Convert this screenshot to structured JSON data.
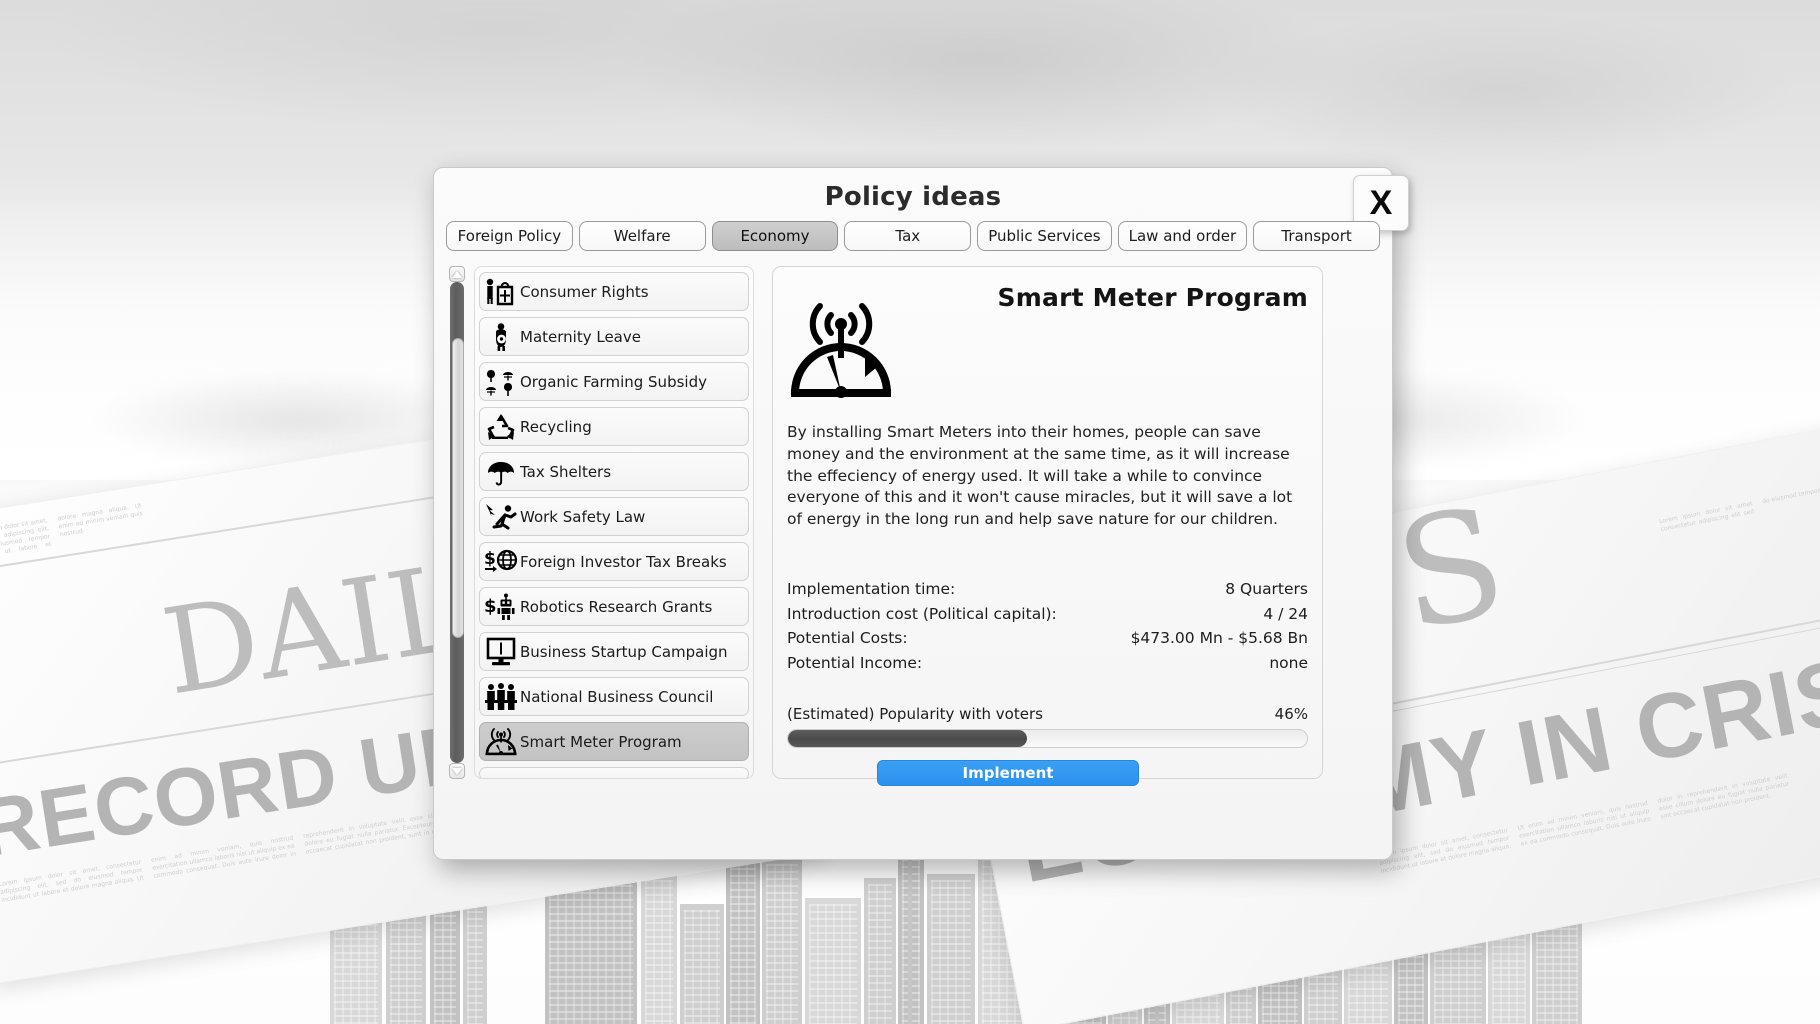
{
  "background": {
    "newspapers": [
      {
        "masthead": "DAILY N",
        "headline": "RECORD UNEMPLOYMENT!"
      },
      {
        "masthead": "NEWS",
        "headline": "ECONOMY IN CRISIS"
      }
    ],
    "scene": "grayscale-city-skyline"
  },
  "dialog": {
    "title": "Policy ideas",
    "close_label": "X",
    "tabs": [
      {
        "label": "Foreign Policy",
        "active": false
      },
      {
        "label": "Welfare",
        "active": false
      },
      {
        "label": "Economy",
        "active": true
      },
      {
        "label": "Tax",
        "active": false
      },
      {
        "label": "Public Services",
        "active": false
      },
      {
        "label": "Law and order",
        "active": false
      },
      {
        "label": "Transport",
        "active": false
      }
    ],
    "policy_list": [
      {
        "label": "Consumer Rights",
        "icon": "consumer-rights-icon",
        "selected": false
      },
      {
        "label": "Maternity Leave",
        "icon": "maternity-leave-icon",
        "selected": false
      },
      {
        "label": "Organic Farming Subsidy",
        "icon": "organic-farming-icon",
        "selected": false
      },
      {
        "label": "Recycling",
        "icon": "recycling-icon",
        "selected": false
      },
      {
        "label": "Tax Shelters",
        "icon": "umbrella-icon",
        "selected": false
      },
      {
        "label": "Work Safety Law",
        "icon": "work-safety-icon",
        "selected": false
      },
      {
        "label": "Foreign Investor Tax Breaks",
        "icon": "dollar-globe-icon",
        "selected": false
      },
      {
        "label": "Robotics Research Grants",
        "icon": "dollar-robot-icon",
        "selected": false
      },
      {
        "label": "Business Startup Campaign",
        "icon": "monitor-icon",
        "selected": false
      },
      {
        "label": "National Business Council",
        "icon": "people-group-icon",
        "selected": false
      },
      {
        "label": "Smart Meter Program",
        "icon": "smart-meter-icon",
        "selected": true
      }
    ],
    "detail": {
      "title": "Smart Meter Program",
      "icon": "smart-meter-icon",
      "description": "By installing Smart Meters into their homes, people can save money and the environment at the same time, as it will increase the effeciency of energy used. It will take a while to convince everyone of this and it won't cause miracles, but it will save a lot of energy in the long run and help save nature for our children.",
      "stats": [
        {
          "label": "Implementation time:",
          "value": "8 Quarters"
        },
        {
          "label": "Introduction cost (Political capital):",
          "value": "4 / 24"
        },
        {
          "label": "Potential Costs:",
          "value": "$473.00 Mn - $5.68 Bn"
        },
        {
          "label": "Potential Income:",
          "value": "none"
        }
      ],
      "popularity": {
        "label": "(Estimated) Popularity with voters",
        "value": "46%",
        "percent": 46
      },
      "implement_label": "Implement"
    }
  },
  "colors": {
    "accent_blue": "#2a92ef",
    "tab_active": "#c6c6c6",
    "selected_row": "#c8c8c8",
    "bar_fill": "#4f4f4f"
  }
}
